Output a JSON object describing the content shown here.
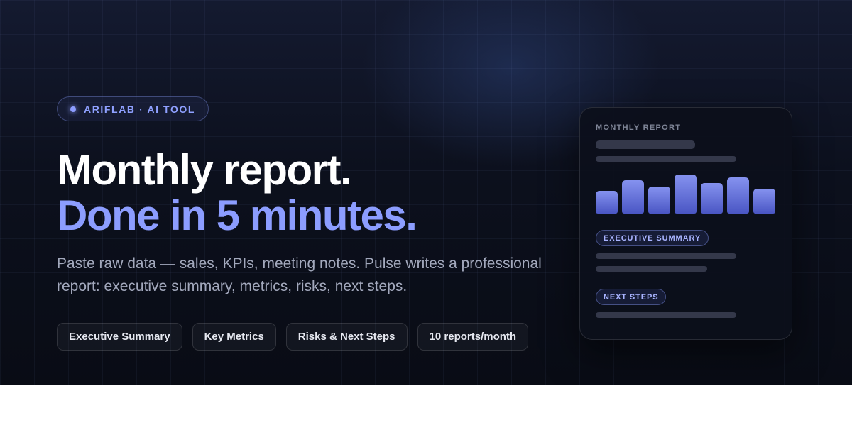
{
  "badge": {
    "label": "ARIFLAB · AI TOOL"
  },
  "hero": {
    "title_line1": "Monthly report.",
    "title_line2": "Done in 5 minutes.",
    "subtitle": "Paste raw data — sales, KPIs, meeting notes. Pulse writes a professional report: executive summary, metrics, risks, next steps."
  },
  "chips": [
    "Executive Summary",
    "Key Metrics",
    "Risks & Next Steps",
    "10 reports/month"
  ],
  "card": {
    "label": "MONTHLY REPORT",
    "bar_values": [
      0.58,
      0.85,
      0.69,
      1.0,
      0.78,
      0.93,
      0.64
    ],
    "section1": "EXECUTIVE SUMMARY",
    "section2": "NEXT STEPS"
  },
  "colors": {
    "accent": "#8c9dff",
    "background": "#0c101d",
    "bar_top": "#8592ef",
    "bar_bottom": "#4a56c4"
  }
}
